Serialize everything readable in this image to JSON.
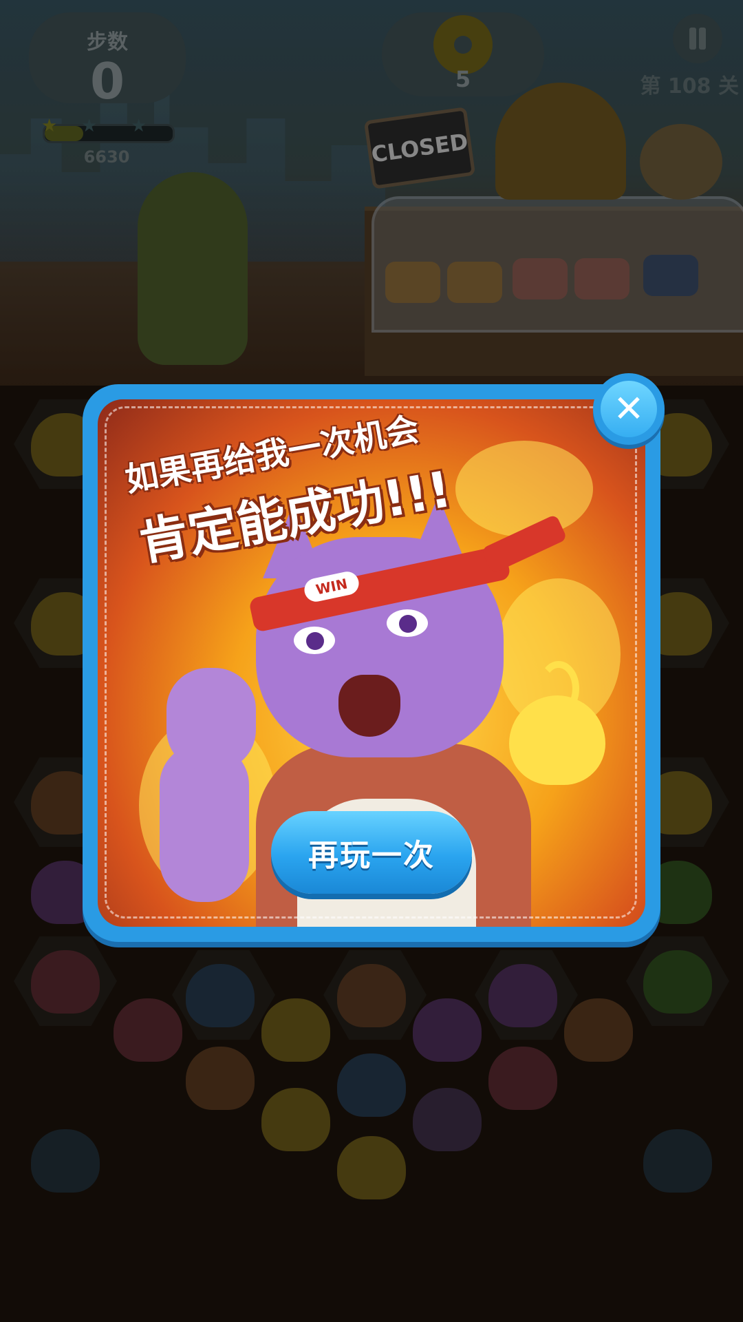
{
  "hud": {
    "moves_label": "步数",
    "moves_value": "0",
    "score": "6630",
    "score_progress": 0.3,
    "goal_icon": "donut-icon",
    "goal_count": "5",
    "level": "第 108 关"
  },
  "scene": {
    "sign_text": "CLOSED"
  },
  "modal": {
    "headline_line1": "如果再给我一次机会",
    "headline_line2": "肯定能成功!!!",
    "badge_text": "WIN",
    "retry_label": "再玩一次",
    "close_icon": "close-icon"
  },
  "colors": {
    "modal_frame": "#2a9be4",
    "button_blue": "#2aa4ef",
    "fire_orange": "#f6a21a"
  }
}
